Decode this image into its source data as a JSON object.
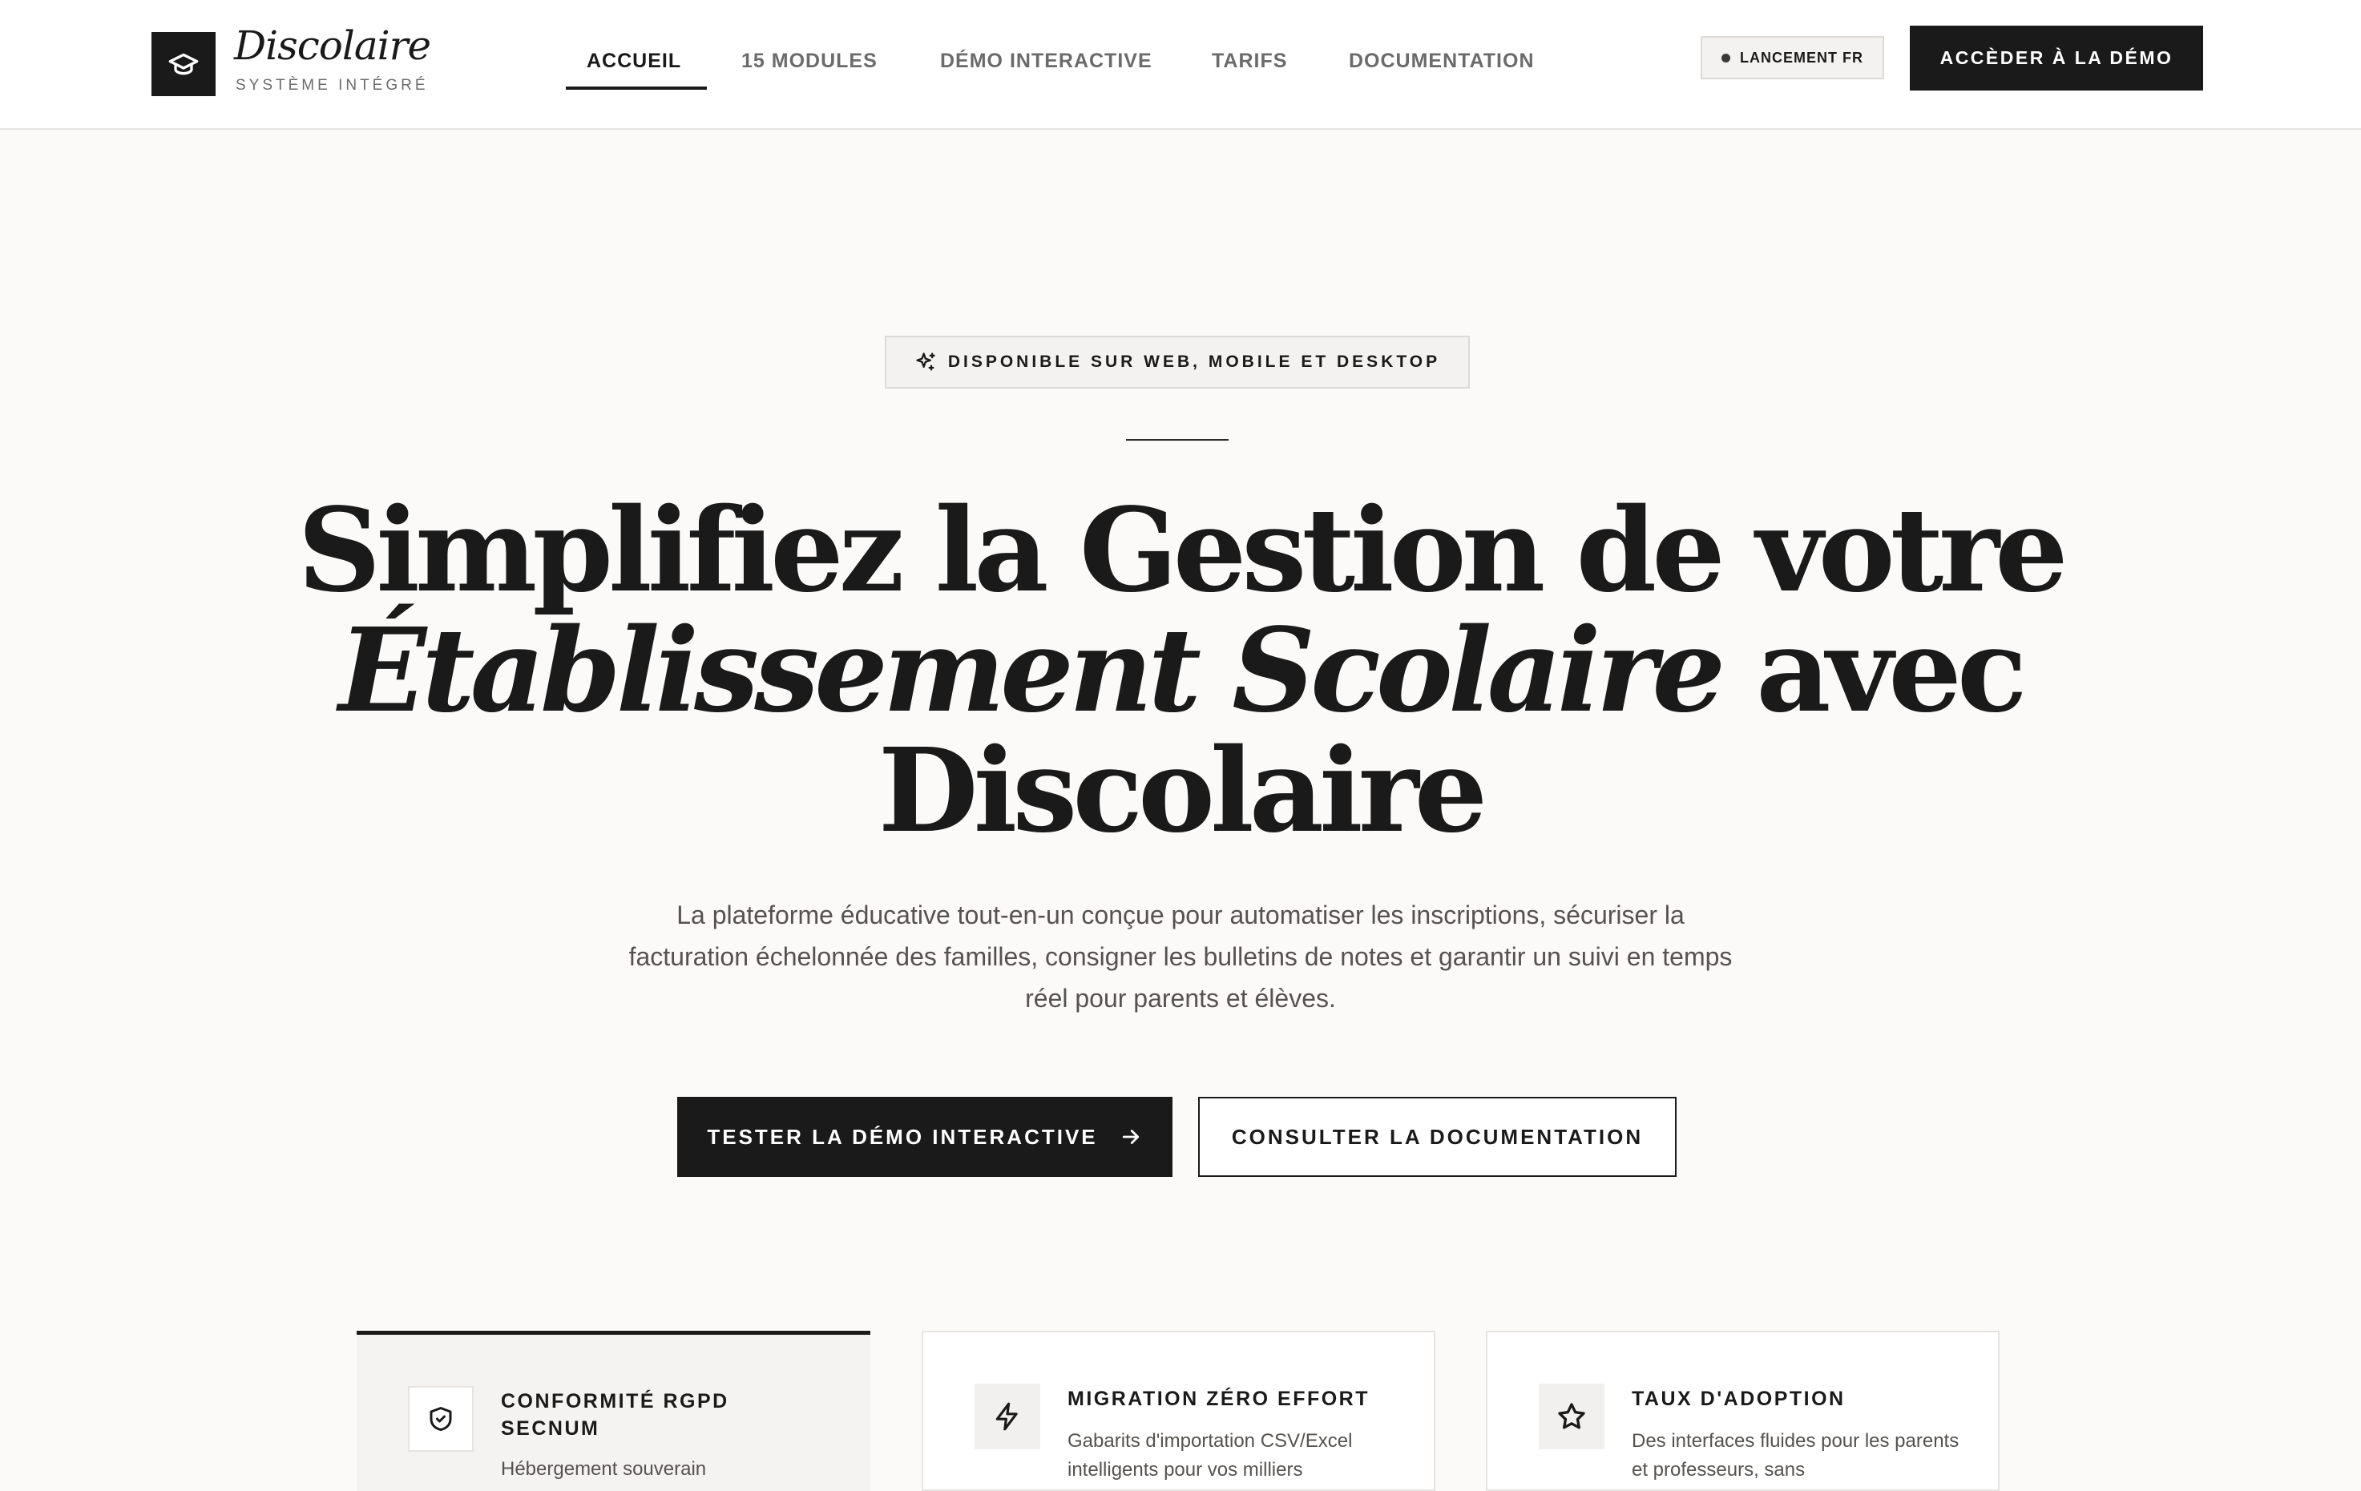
{
  "brand": {
    "name": "Discolaire",
    "tagline": "SYSTÈME INTÉGRÉ",
    "logo_icon": "graduation-cap-icon"
  },
  "nav": {
    "items": [
      {
        "label": "ACCUEIL",
        "active": true
      },
      {
        "label": "15 MODULES",
        "active": false
      },
      {
        "label": "DÉMO INTERACTIVE",
        "active": false
      },
      {
        "label": "TARIFS",
        "active": false
      },
      {
        "label": "DOCUMENTATION",
        "active": false
      }
    ]
  },
  "header": {
    "launch_badge": "LANCEMENT FR",
    "demo_button": "ACCÈDER À LA DÉMO"
  },
  "hero": {
    "availability": "DISPONIBLE SUR WEB, MOBILE ET DESKTOP",
    "availability_icon": "sparkles-icon",
    "title_line1": "Simplifiez la Gestion de votre",
    "title_line2_italic": "Établissement Scolaire",
    "title_line2_rest": " avec",
    "title_line3": "Discolaire",
    "subtitle": "La plateforme éducative tout-en-un conçue pour automatiser les inscriptions, sécuriser la facturation échelonnée des familles, consigner les bulletins de notes et garantir un suivi en temps réel pour parents et élèves.",
    "primary_cta": "TESTER LA DÉMO INTERACTIVE",
    "primary_cta_icon": "arrow-right-icon",
    "secondary_cta": "CONSULTER LA DOCUMENTATION"
  },
  "features": [
    {
      "title": "CONFORMITÉ RGPD SECNUM",
      "text": "Hébergement souverain",
      "icon": "shield-check-icon",
      "active": true
    },
    {
      "title": "MIGRATION ZÉRO EFFORT",
      "text": "Gabarits d'importation CSV/Excel intelligents pour vos milliers",
      "icon": "lightning-icon",
      "active": false
    },
    {
      "title": "TAUX D'ADOPTION",
      "text": "Des interfaces fluides pour les parents et professeurs, sans",
      "icon": "star-icon",
      "active": false
    }
  ],
  "colors": {
    "background": "#fbfaf9",
    "ink": "#1a1a1a",
    "muted": "#6b6b6b",
    "border": "#e6e4e1"
  }
}
